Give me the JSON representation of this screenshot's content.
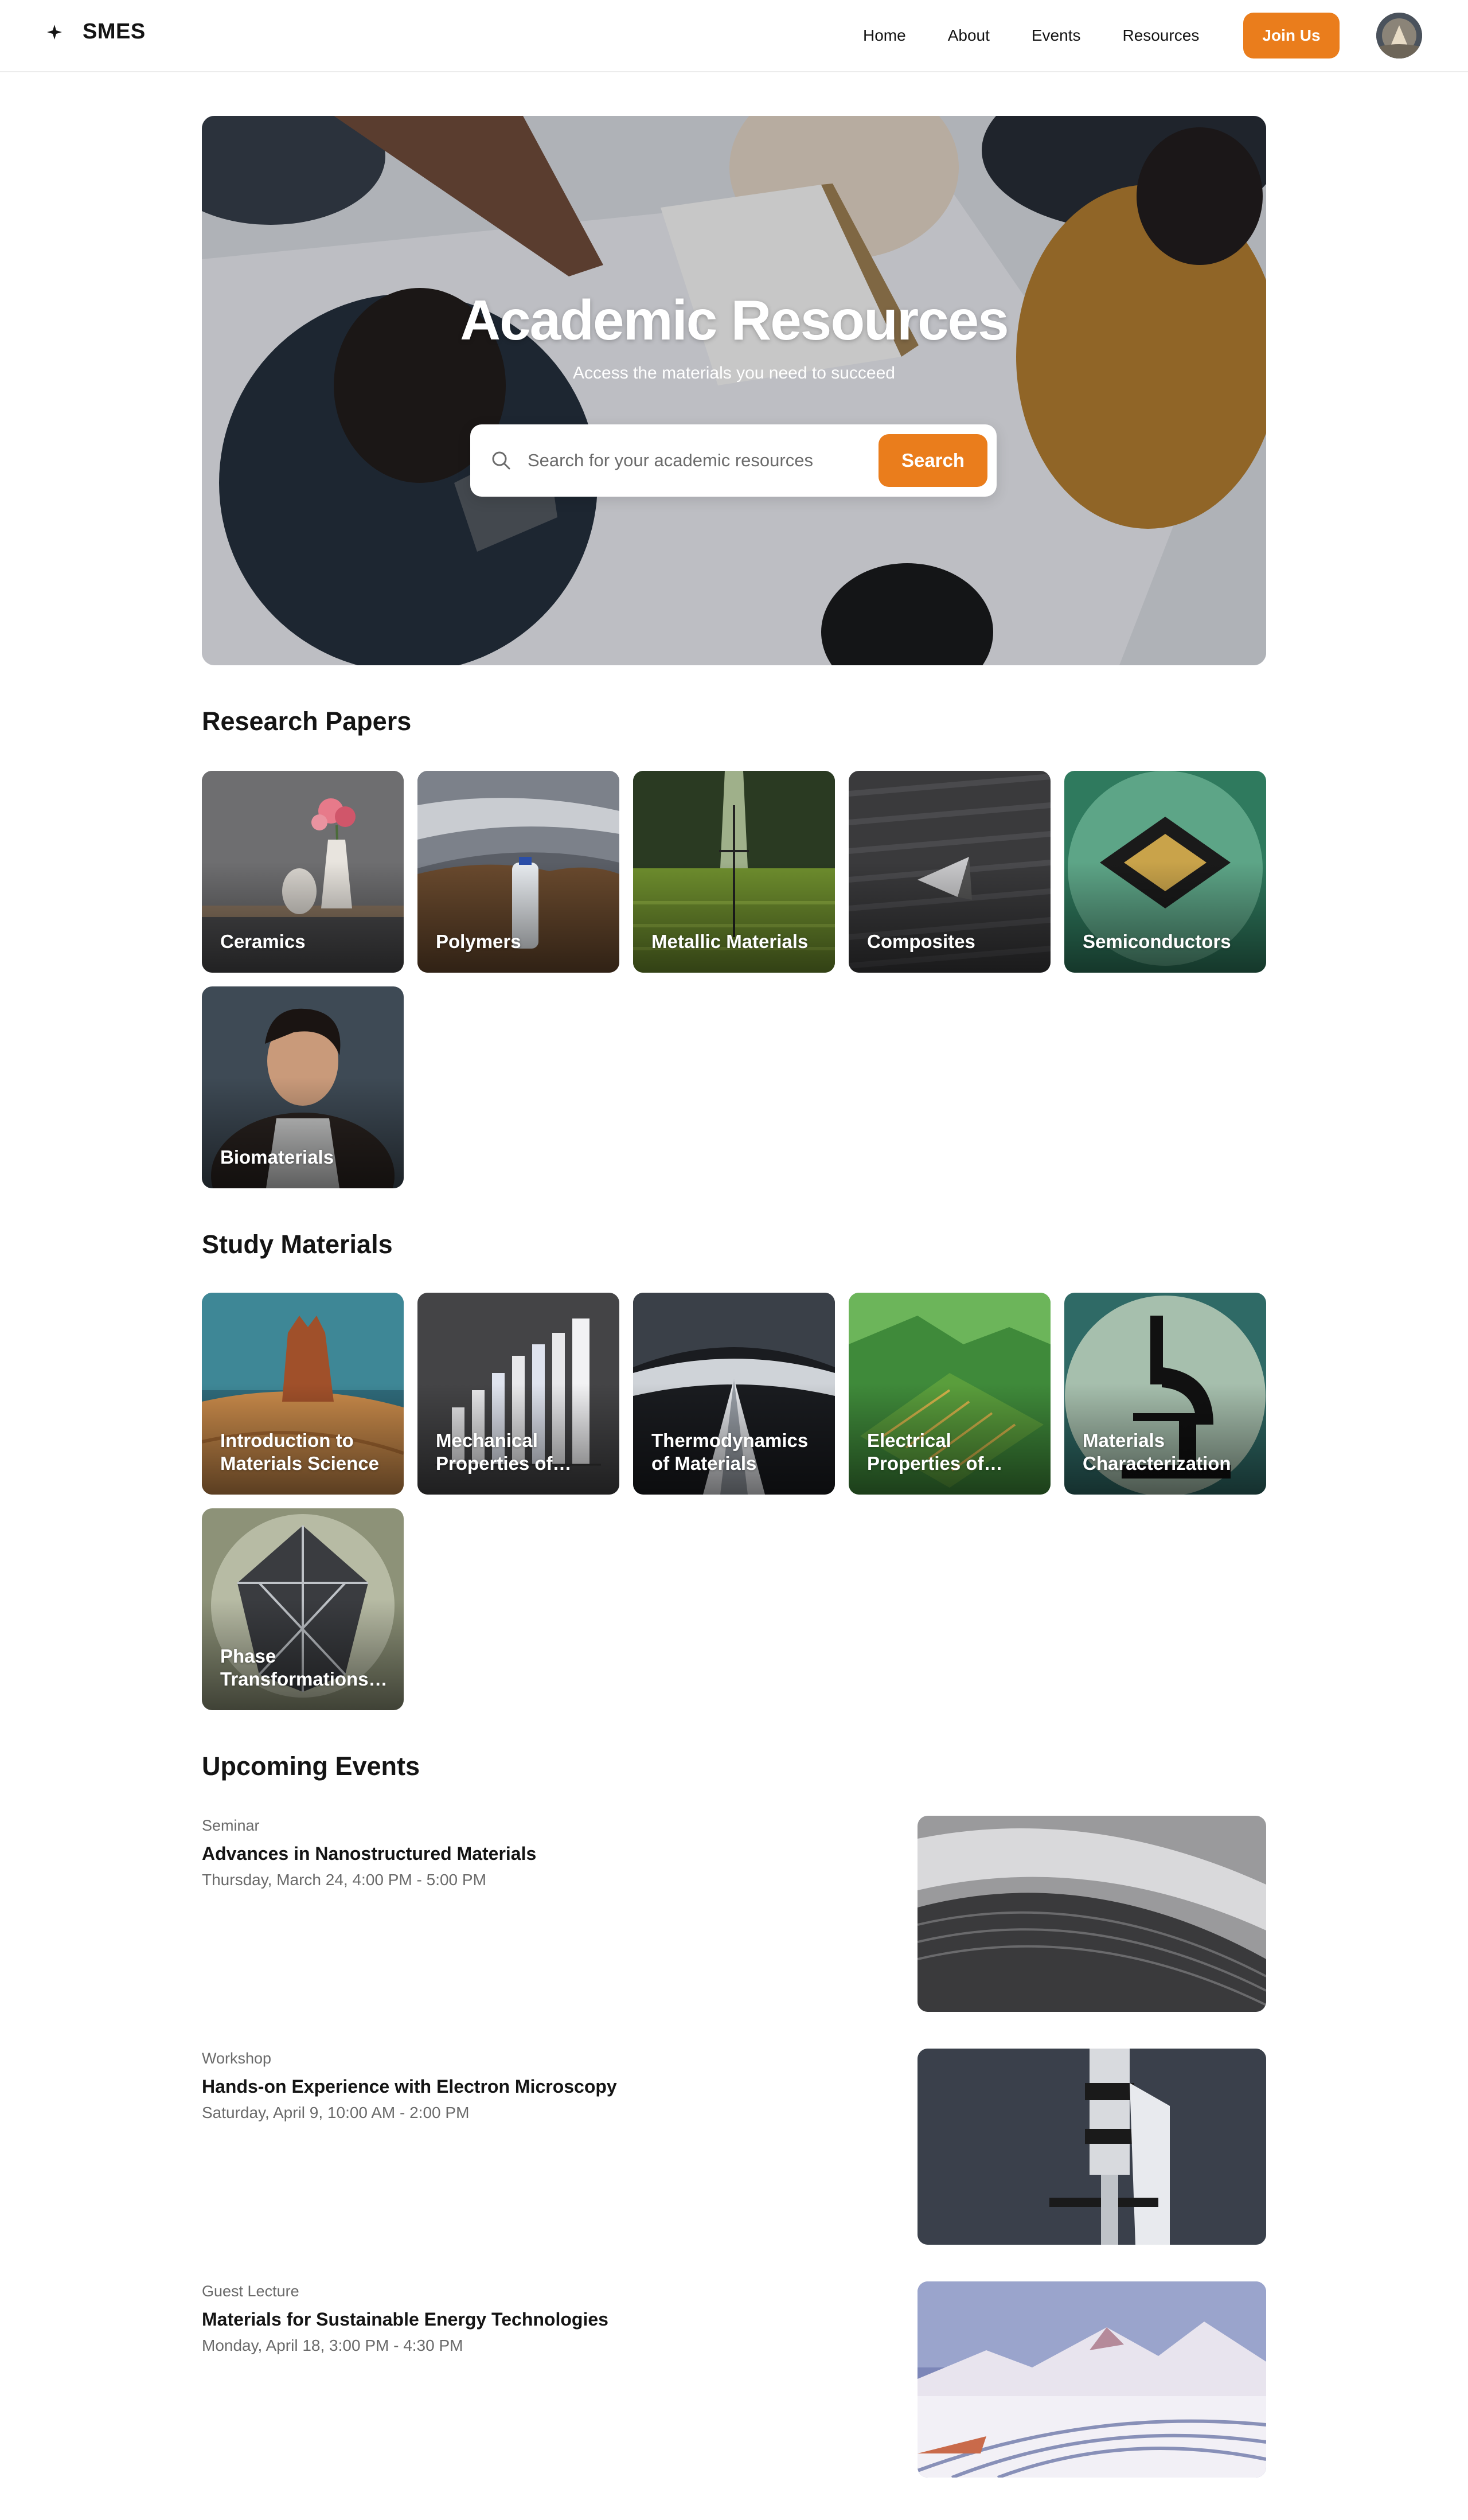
{
  "header": {
    "brand": "SMES",
    "nav": [
      "Home",
      "About",
      "Events",
      "Resources"
    ],
    "join_label": "Join Us"
  },
  "hero": {
    "title": "Academic Resources",
    "subtitle": "Access the materials you need to succeed",
    "search_placeholder": "Search for your academic resources",
    "search_button": "Search"
  },
  "research": {
    "title": "Research Papers",
    "items": [
      "Ceramics",
      "Polymers",
      "Metallic Materials",
      "Composites",
      "Semiconductors",
      "Biomaterials"
    ]
  },
  "study": {
    "title": "Study Materials",
    "items": [
      "Introduction to Materials Science",
      "Mechanical Properties of Materials",
      "Thermodynamics of Materials",
      "Electrical Properties of Materials",
      "Materials Characterization",
      "Phase Transformations in Materials"
    ]
  },
  "events": {
    "title": "Upcoming Events",
    "items": [
      {
        "type": "Seminar",
        "title": "Advances in Nanostructured Materials",
        "time": "Thursday, March 24, 4:00 PM - 5:00 PM"
      },
      {
        "type": "Workshop",
        "title": "Hands-on Experience with Electron Microscopy",
        "time": "Saturday, April 9, 10:00 AM - 2:00 PM"
      },
      {
        "type": "Guest Lecture",
        "title": "Materials for Sustainable Energy Technologies",
        "time": "Monday, April 18, 3:00 PM - 4:30 PM"
      }
    ]
  },
  "colors": {
    "accent": "#ea7d1c",
    "text": "#141414",
    "muted": "#6a6a6a"
  }
}
